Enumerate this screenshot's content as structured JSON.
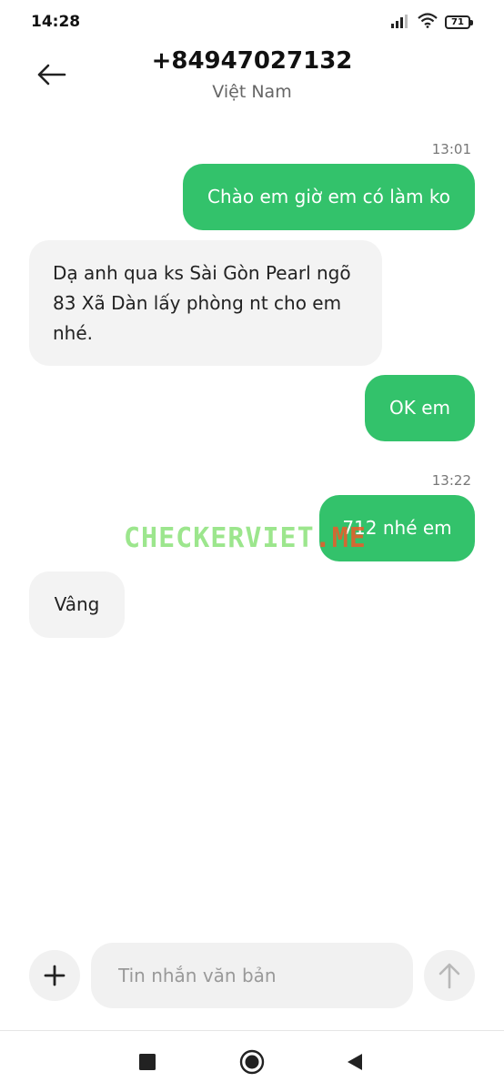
{
  "status_bar": {
    "time": "14:28",
    "battery": "71",
    "icons": [
      "signal-icon",
      "wifi-icon",
      "battery-icon"
    ]
  },
  "header": {
    "title": "+84947027132",
    "subtitle": "Việt Nam",
    "back_icon": "arrow-left-icon"
  },
  "conversation": {
    "messages": [
      {
        "timestamp": "13:01",
        "direction": "outgoing",
        "text": "Chào em giờ em có làm ko"
      },
      {
        "direction": "incoming",
        "text": "Dạ anh qua ks Sài Gòn Pearl ngõ 83 Xã Dàn lấy phòng nt cho em nhé."
      },
      {
        "direction": "outgoing",
        "text": "OK em"
      },
      {
        "timestamp": "13:22",
        "direction": "outgoing",
        "text": "712 nhé em"
      },
      {
        "direction": "incoming",
        "text": "Vâng"
      }
    ]
  },
  "watermark": {
    "main": "CHECKERVIET",
    "accent": ".ME"
  },
  "composer": {
    "placeholder": "Tin nhắn văn bản",
    "value": "",
    "attach_icon": "plus-icon",
    "send_icon": "arrow-up-icon"
  },
  "navbar": {
    "icons": [
      "square-icon",
      "circle-icon",
      "triangle-back-icon"
    ]
  },
  "colors": {
    "outgoing_bubble": "#33c26b",
    "incoming_bubble": "#f3f3f3",
    "background": "#ffffff"
  }
}
